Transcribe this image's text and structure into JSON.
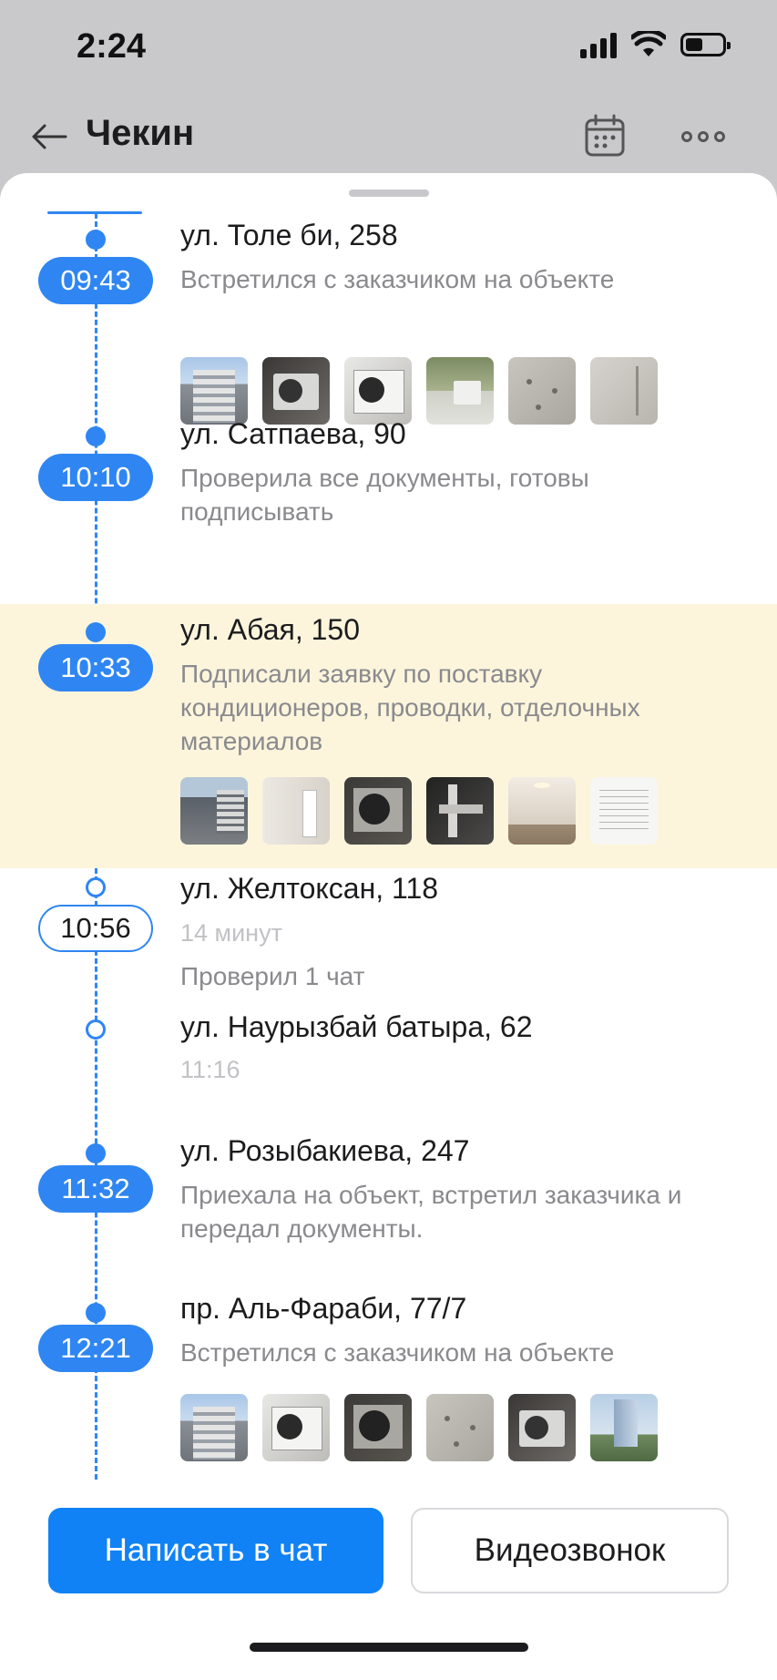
{
  "status_bar": {
    "time": "2:24"
  },
  "header": {
    "title": "Чекин"
  },
  "icons": {
    "back": "arrow-left-icon",
    "calendar": "calendar-icon",
    "more": "more-horizontal-icon"
  },
  "timeline": [
    {
      "time": "09:43",
      "address": "ул. Толе би, 258",
      "description": "Встретился с заказчиком на объекте",
      "photos": 6,
      "highlighted": false,
      "filled": true
    },
    {
      "time": "10:10",
      "address": "ул. Сатпаева, 90",
      "description": "Проверила все документы, готовы подписывать",
      "photos": 0,
      "highlighted": false,
      "filled": true
    },
    {
      "time": "10:33",
      "address": "ул. Абая, 150",
      "description": "Подписали заявку по поставку кондиционеров, проводки, отделочных материалов",
      "photos": 6,
      "highlighted": true,
      "filled": true
    },
    {
      "time": "10:56",
      "address": "ул. Желтоксан, 118",
      "duration": "14 минут",
      "description": "Проверил 1 чат",
      "photos": 0,
      "highlighted": false,
      "filled": false
    },
    {
      "time": "11:16",
      "address": "ул. Наурызбай батыра, 62",
      "photos": 0,
      "highlighted": false,
      "filled": false
    },
    {
      "time": "11:32",
      "address": "ул. Розыбакиева, 247",
      "description": "Приехала на объект, встретил заказчика и передал документы.",
      "photos": 0,
      "highlighted": false,
      "filled": true
    },
    {
      "time": "12:21",
      "address": "пр. Аль-Фараби, 77/7",
      "description": "Встретился с заказчиком на объекте",
      "photos": 6,
      "highlighted": false,
      "filled": true
    }
  ],
  "actions": {
    "chat_label": "Написать в чат",
    "video_label": "Видеозвонок"
  },
  "colors": {
    "accent": "#2f86f2",
    "primary_button": "#1082f5",
    "highlight_bg": "#fcf5dc"
  }
}
